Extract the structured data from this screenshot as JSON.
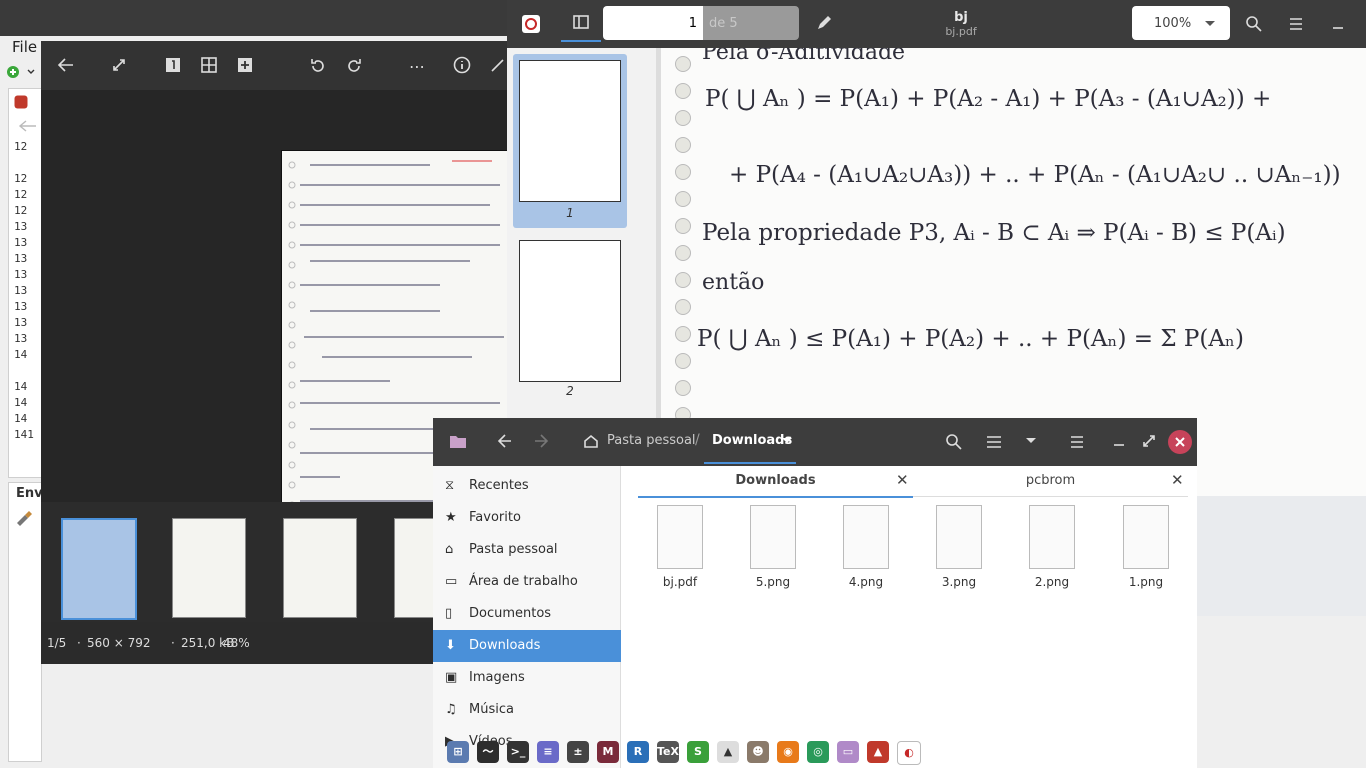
{
  "background_app": {
    "menu_file": "File",
    "line_numbers": [
      "12",
      "12",
      "12",
      "12",
      "13",
      "13",
      "13",
      "13",
      "13",
      "13",
      "13",
      "13",
      "14",
      "14",
      "14",
      "14",
      "141"
    ],
    "bottom_tab": "Env"
  },
  "image_viewer": {
    "status": {
      "index": "1/5",
      "dimensions": "560 × 792",
      "size": "251,0 kB",
      "zoom": "48%"
    }
  },
  "pdf_viewer": {
    "title": "bj",
    "subtitle": "bj.pdf",
    "page_input": "1",
    "page_total": "de 5",
    "zoom": "100%",
    "thumbnails": [
      {
        "label": "1"
      },
      {
        "label": "2"
      }
    ]
  },
  "file_manager": {
    "breadcrumb_home": "Pasta pessoal",
    "breadcrumb_current": "Downloads",
    "sidebar": [
      {
        "label": "Recentes",
        "icon": "clock-icon"
      },
      {
        "label": "Favorito",
        "icon": "star-icon"
      },
      {
        "label": "Pasta pessoal",
        "icon": "home-icon"
      },
      {
        "label": "Área de trabalho",
        "icon": "desktop-icon"
      },
      {
        "label": "Documentos",
        "icon": "document-icon"
      },
      {
        "label": "Downloads",
        "icon": "download-icon",
        "active": true
      },
      {
        "label": "Imagens",
        "icon": "image-icon"
      },
      {
        "label": "Música",
        "icon": "music-icon"
      },
      {
        "label": "Vídeos",
        "icon": "video-icon"
      }
    ],
    "tabs": [
      {
        "label": "Downloads",
        "active": true
      },
      {
        "label": "pcbrom",
        "active": false
      }
    ],
    "files": [
      "bj.pdf",
      "5.png",
      "4.png",
      "3.png",
      "2.png",
      "1.png"
    ]
  },
  "pdf_page_text": {
    "heading": "Pela σ-Aditividade",
    "line1": "P( ⋃ Aₙ ) = P(A₁) + P(A₂ - A₁) + P(A₃ - (A₁∪A₂)) +",
    "line2": "+ P(A₄ - (A₁∪A₂∪A₃)) + .. + P(Aₙ - (A₁∪A₂∪ .. ∪Aₙ₋₁))",
    "line3": "Pela propriedade  P3,   Aᵢ - B ⊂ Aᵢ  ⇒ P(Aᵢ - B) ≤ P(Aᵢ)",
    "line4": "então",
    "line5": "P( ⋃ Aₙ ) ≤ P(A₁) + P(A₂) + .. + P(Aₙ) = Σ P(Aₙ)"
  },
  "colors": {
    "accent": "#4a90d9",
    "close_button": "#c7435a",
    "header_dark": "#3c3c3c"
  }
}
